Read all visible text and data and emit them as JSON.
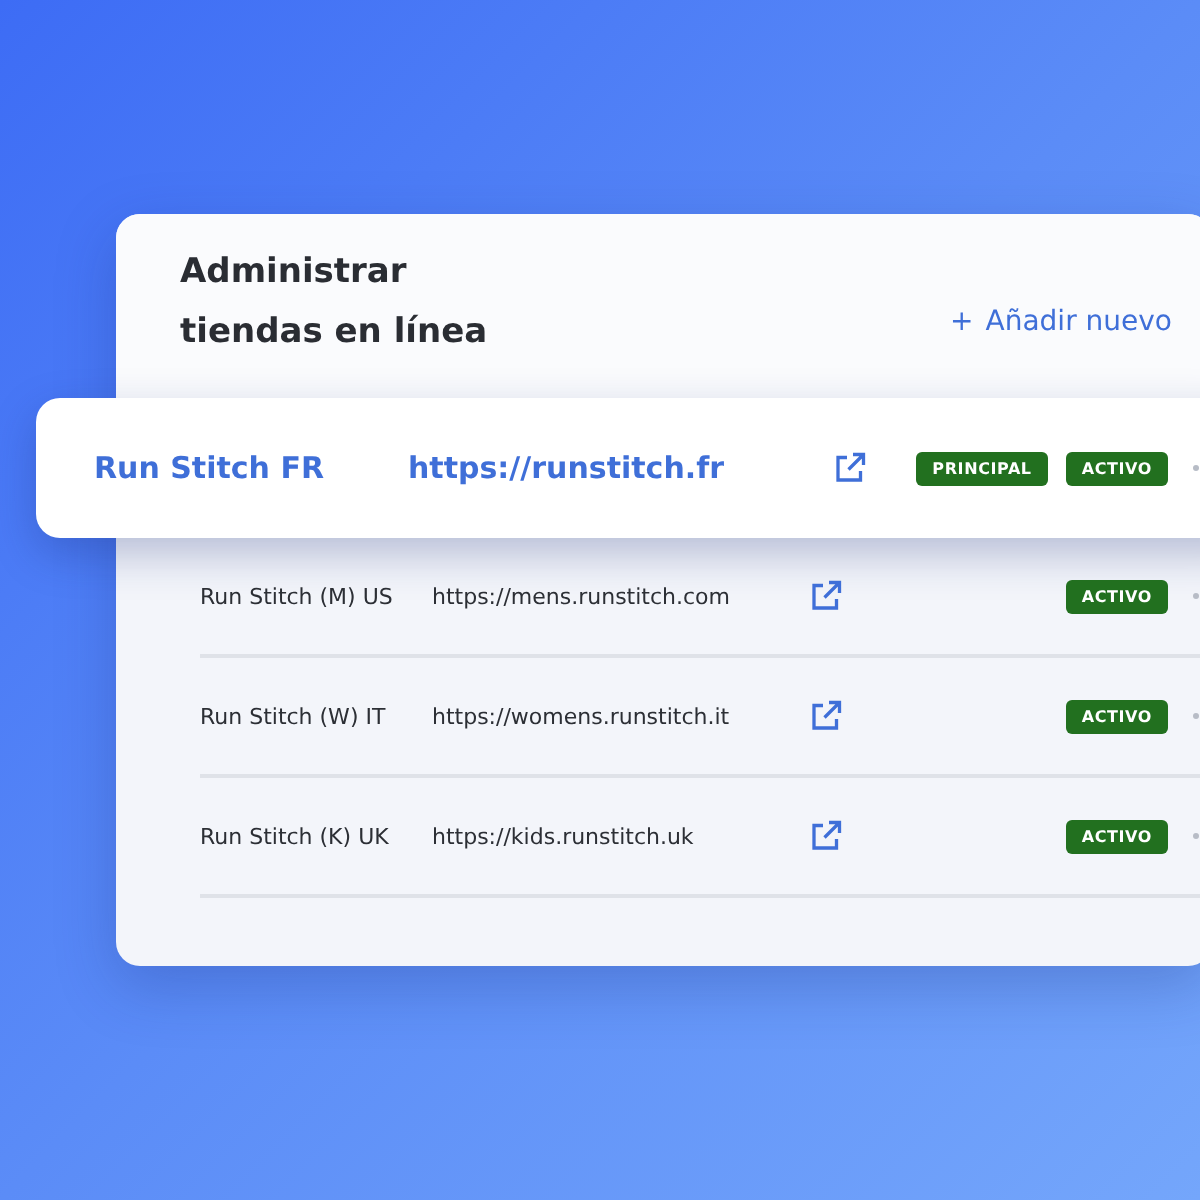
{
  "title": "Administrar tiendas en línea",
  "add_button": {
    "icon": "+",
    "label": "Añadir nuevo"
  },
  "stores": [
    {
      "name": "Run Stitch FR",
      "url": "https://runstitch.fr",
      "highlighted": true,
      "badges": [
        "PRINCIPAL",
        "ACTIVO"
      ]
    },
    {
      "name": "Run Stitch (M) US",
      "url": "https://mens.runstitch.com",
      "highlighted": false,
      "badges": [
        "ACTIVO"
      ]
    },
    {
      "name": "Run Stitch (W) IT",
      "url": "https://womens.runstitch.it",
      "highlighted": false,
      "badges": [
        "ACTIVO"
      ]
    },
    {
      "name": "Run Stitch (K) UK",
      "url": "https://kids.runstitch.uk",
      "highlighted": false,
      "badges": [
        "ACTIVO"
      ]
    }
  ]
}
